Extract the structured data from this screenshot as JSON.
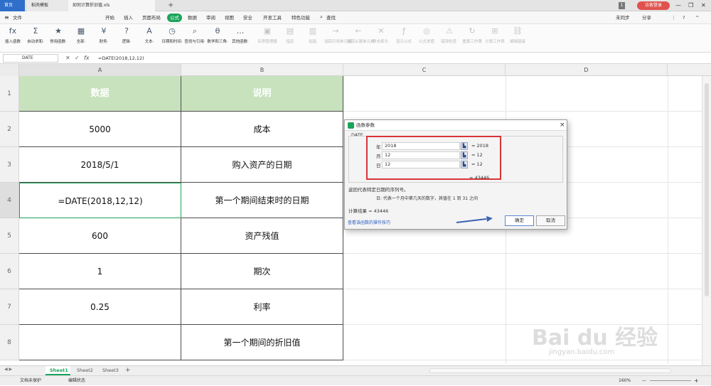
{
  "tabs": [
    {
      "label": "首页",
      "active": false
    },
    {
      "label": "稻壳模板",
      "active": false
    },
    {
      "label": "如何计算折旧值.xls",
      "active": true
    }
  ],
  "tab_new": "+",
  "user": {
    "login_label": "访客登录",
    "badge": "1"
  },
  "window_controls": {
    "minimize": "—",
    "restore": "❐",
    "close": "✕"
  },
  "menu": {
    "file": "文件",
    "items": [
      "开始",
      "插入",
      "页面布局",
      "公式",
      "数据",
      "审阅",
      "视图",
      "安全",
      "开发工具",
      "特色功能"
    ],
    "active": "公式",
    "search": "查找",
    "sync": "未同步",
    "share": "分享",
    "more": "⋮",
    "help": "?",
    "collapse": "^"
  },
  "ribbon": {
    "items": [
      {
        "label": "插入函数",
        "icon": "fx",
        "dis": false
      },
      {
        "label": "自动求和·",
        "icon": "Σ",
        "dis": false
      },
      {
        "label": "常用函数·",
        "icon": "★",
        "dis": false
      },
      {
        "label": "全部·",
        "icon": "▦",
        "dis": false
      },
      {
        "label": "财务·",
        "icon": "¥",
        "dis": false
      },
      {
        "label": "逻辑·",
        "icon": "?",
        "dis": false
      },
      {
        "label": "文本·",
        "icon": "A",
        "dis": false
      },
      {
        "label": "日期和时间·",
        "icon": "◷",
        "dis": false
      },
      {
        "label": "查找与引用·",
        "icon": "⌕",
        "dis": false
      },
      {
        "label": "数学和三角·",
        "icon": "θ",
        "dis": false
      },
      {
        "label": "其他函数·",
        "icon": "…",
        "dis": false
      },
      {
        "label": "名称管理器",
        "icon": "▣",
        "dis": true
      },
      {
        "label": "指定",
        "icon": "▤",
        "dis": true
      },
      {
        "label": "粘贴",
        "icon": "▥",
        "dis": true
      },
      {
        "label": "追踪引用单元格",
        "icon": "→",
        "dis": true
      },
      {
        "label": "追踪从属单元格",
        "icon": "←",
        "dis": true
      },
      {
        "label": "移去箭头·",
        "icon": "✕",
        "dis": true
      },
      {
        "label": "显示公式",
        "icon": "ƒ",
        "dis": true
      },
      {
        "label": "公式求值",
        "icon": "◎",
        "dis": true
      },
      {
        "label": "错误检查·",
        "icon": "⚠",
        "dis": true
      },
      {
        "label": "重算工作簿",
        "icon": "↻",
        "dis": true
      },
      {
        "label": "计算工作表",
        "icon": "⊞",
        "dis": true
      },
      {
        "label": "编辑链接",
        "icon": "⛓",
        "dis": true
      }
    ]
  },
  "formula_bar": {
    "name_box": "DATE",
    "cancel": "✕",
    "confirm": "✓",
    "fx": "fx",
    "formula": "=DATE(2018,12,12)"
  },
  "columns": [
    "A",
    "B",
    "C",
    "D"
  ],
  "rows": [
    {
      "num": "1",
      "a": "数据",
      "b": "说明",
      "header": true
    },
    {
      "num": "2",
      "a": "5000",
      "b": "成本",
      "header": false
    },
    {
      "num": "3",
      "a": "2018/5/1",
      "b": "购入资产的日期",
      "header": false
    },
    {
      "num": "4",
      "a": "=DATE(2018,12,12)",
      "b": "第一个期间结束时的日期",
      "header": false
    },
    {
      "num": "5",
      "a": "600",
      "b": "资产残值",
      "header": false
    },
    {
      "num": "6",
      "a": "1",
      "b": "期次",
      "header": false
    },
    {
      "num": "7",
      "a": "0.25",
      "b": "利率",
      "header": false
    },
    {
      "num": "8",
      "a": "",
      "b": "第一个期间的折旧值",
      "header": false
    }
  ],
  "dialog": {
    "title": "函数参数",
    "function_name": "DATE",
    "close": "×",
    "args": [
      {
        "label": "年",
        "value": "2018",
        "result": "= 2018"
      },
      {
        "label": "月",
        "value": "12",
        "result": "= 12"
      },
      {
        "label": "日",
        "value": "12",
        "result": "= 12"
      }
    ],
    "total_result": "= 43446",
    "description": "返回代表特定日期的序列号。",
    "arg_description": "日: 代表一个月中第几天的数字，其值在 1 到 31 之间",
    "calc_result": "计算结果 = 43446",
    "help_link": "查看该函数的操作技巧",
    "ok_label": "确定",
    "cancel_label": "取消"
  },
  "sheets": {
    "tabs": [
      "Sheet1",
      "Sheet2",
      "Sheet3"
    ],
    "active": "Sheet1",
    "add": "+"
  },
  "status": {
    "protect": "文档未保护",
    "mode": "编辑状态",
    "zoom": "160%",
    "zoom_minus": "—",
    "zoom_plus": "+"
  },
  "watermark": {
    "brand": "Bai du 经验",
    "url": "jingyan.baidu.com"
  },
  "colors": {
    "accent": "#1aa35a",
    "header_fill": "#c7e2bd",
    "highlight": "#d9343a",
    "arrow": "#3a63b5"
  }
}
